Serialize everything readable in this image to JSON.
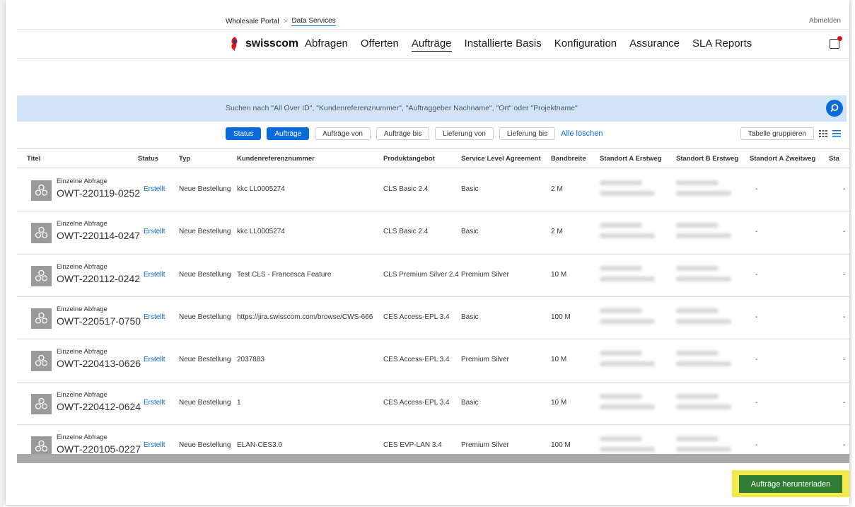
{
  "breadcrumb": {
    "root": "Wholesale Portal",
    "separator": ">",
    "current": "Data Services"
  },
  "header": {
    "logout": "Abmelden",
    "notification_icon": "notification-bell-icon",
    "accent": "#086adb",
    "alert": "#e0131d"
  },
  "logo": {
    "text": "swisscom"
  },
  "nav": [
    "Abfragen",
    "Offerten",
    "Aufträge",
    "Installierte Basis",
    "Konfiguration",
    "Assurance",
    "SLA Reports"
  ],
  "nav_active": "Aufträge",
  "search": {
    "placeholder": "Suchen nach \"All Over ID\", \"Kundenreferenznummer\", \"Auftraggeber Nachname\", \"Ort\" oder \"Projektname\""
  },
  "filters": {
    "chips": [
      {
        "label": "Status",
        "active": true
      },
      {
        "label": "Aufträge",
        "active": true
      },
      {
        "label": "Aufträge von",
        "active": false
      },
      {
        "label": "Aufträge bis",
        "active": false
      },
      {
        "label": "Lieferung von",
        "active": false
      },
      {
        "label": "Lieferung bis",
        "active": false
      }
    ],
    "clear_all": "Alle löschen",
    "group_table": "Tabelle gruppieren"
  },
  "table": {
    "columns": [
      "Titel",
      "Status",
      "Typ",
      "Kundenreferenznummer",
      "Produktangebot",
      "Service Level Agreement",
      "Bandbreite",
      "Standort A Erstweg",
      "Standort B Erstweg",
      "Standort A Zweitweg",
      "Sta"
    ],
    "rows": [
      {
        "subtitle": "Einzelne Abfrage",
        "id": "OWT-220119-0252",
        "status": "Erstellt",
        "type": "Neue Bestellung",
        "ref": "kkc LL0005274",
        "product": "CLS Basic 2.4",
        "sla": "Basic",
        "bandwidth": "2 M",
        "a2": "-",
        "next": "-"
      },
      {
        "subtitle": "Einzelne Abfrage",
        "id": "OWT-220114-0247",
        "status": "Erstellt",
        "type": "Neue Bestellung",
        "ref": "kkc LL0005274",
        "product": "CLS Basic 2.4",
        "sla": "Basic",
        "bandwidth": "2 M",
        "a2": "-",
        "next": "-"
      },
      {
        "subtitle": "Einzelne Abfrage",
        "id": "OWT-220112-0242",
        "status": "Erstellt",
        "type": "Neue Bestellung",
        "ref": "Test CLS - Francesca Feature",
        "product": "CLS Premium Silver 2.4",
        "sla": "Premium Silver",
        "bandwidth": "10 M",
        "a2": "-",
        "next": "-"
      },
      {
        "subtitle": "Einzelne Abfrage",
        "id": "OWT-220517-0750",
        "status": "Erstellt",
        "type": "Neue Bestellung",
        "ref": "https://jira.swisscom.com/browse/CWS-666",
        "product": "CES Access-EPL 3.4",
        "sla": "Basic",
        "bandwidth": "100 M",
        "a2": "-",
        "next": "-"
      },
      {
        "subtitle": "Einzelne Abfrage",
        "id": "OWT-220413-0626",
        "status": "Erstellt",
        "type": "Neue Bestellung",
        "ref": "2037883",
        "product": "CES Access-EPL 3.4",
        "sla": "Premium Silver",
        "bandwidth": "10 M",
        "a2": "-",
        "next": "-"
      },
      {
        "subtitle": "Einzelne Abfrage",
        "id": "OWT-220412-0624",
        "status": "Erstellt",
        "type": "Neue Bestellung",
        "ref": "1",
        "product": "CES Access-EPL 3.4",
        "sla": "Basic",
        "bandwidth": "10 M",
        "a2": "-",
        "next": "-"
      },
      {
        "subtitle": "Einzelne Abfrage",
        "id": "OWT-220105-0227",
        "status": "Erstellt",
        "type": "Neue Bestellung",
        "ref": "ELAN-CES3.0",
        "product": "CES EVP-LAN 3.4",
        "sla": "Premium Silver",
        "bandwidth": "100 M",
        "a2": "-",
        "next": "-"
      }
    ]
  },
  "download_button": "Aufträge herunterladen",
  "colors": {
    "highlight": "#f3e94a",
    "download_bg": "#2e7d32",
    "search_bg": "#cfe4f8"
  }
}
